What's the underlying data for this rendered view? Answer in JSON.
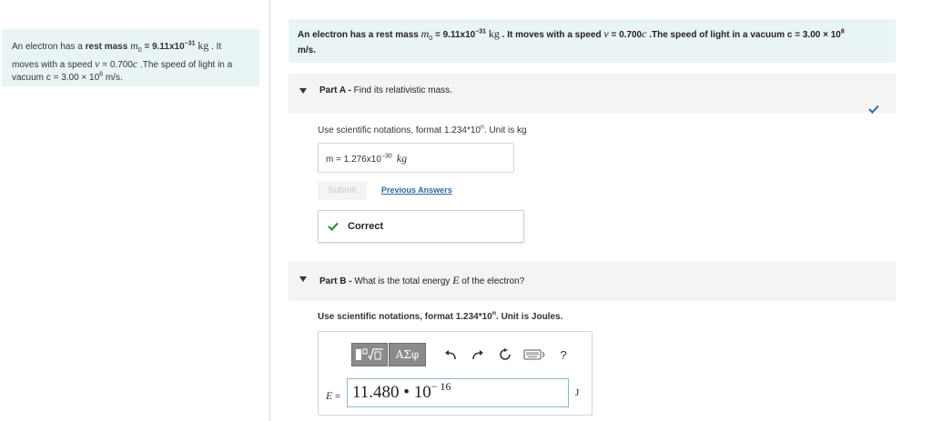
{
  "context": {
    "pre": "An electron has a ",
    "rest_mass": "rest mass",
    "m0_symbol": "m",
    "m0_sub": "0",
    "m0_eq": " = 9.11x10",
    "m0_exp": "−31",
    "m0_unit": "kg",
    "mid": " . It moves with a speed ",
    "v_symbol": "v",
    "v_eq": " = 0.700",
    "c_symbol": "c",
    "post": " .The speed of light in a vacuum c = 3.00 × 10",
    "c_exp": "8",
    "c_unit": " m/s."
  },
  "statement": {
    "pre": "An electron has a rest mass ",
    "m0_symbol": "m",
    "m0_sub": "0",
    "m0_eq": " = 9.11x10",
    "m0_exp": "−31",
    "m0_unit": "kg",
    "mid": " . It moves with a speed ",
    "v_symbol": "v",
    "v_eq": " = 0.700",
    "c_symbol": "c",
    "post": " .The speed of light in a vacuum c = 3.00 × 10",
    "c_exp": "8",
    "c_unit": "m/s."
  },
  "part_a": {
    "label": "Part A - ",
    "question": "Find its relativistic mass.",
    "hint_pre": "Use scientific notations, format 1.234*10",
    "hint_exp": "n",
    "hint_post": ". Unit is kg",
    "answer_prefix": "m = ",
    "answer_value": "1.276x10",
    "answer_exp": "−30",
    "answer_unit": "kg",
    "submit_label": "Submit",
    "previous_answers_label": "Previous Answers",
    "result_label": "Correct",
    "status": "correct"
  },
  "part_b": {
    "label": "Part B - ",
    "question_pre": "What is the total energy ",
    "question_symbol": "E",
    "question_post": " of the electron?",
    "hint_pre": "Use scientific notations, format 1.234*10",
    "hint_exp": "n",
    "hint_post": ". Unit is Joules.",
    "toolbar": {
      "symbols_label": "ΑΣφ",
      "help_label": "?",
      "icons": [
        "templates-icon",
        "undo-icon",
        "redo-icon",
        "reset-icon",
        "keyboard-icon"
      ]
    },
    "input_symbol": "E",
    "input_eq": " =",
    "input_value": "11.480 • 10",
    "input_exp": "− 16",
    "input_unit": "J"
  },
  "colors": {
    "panel_bg": "#e9f4f6",
    "part_header_bg": "#f4f4f4",
    "link": "#2b6aa6",
    "correct": "#2f8f3e",
    "toolbar_btn": "#8b8b8b"
  }
}
